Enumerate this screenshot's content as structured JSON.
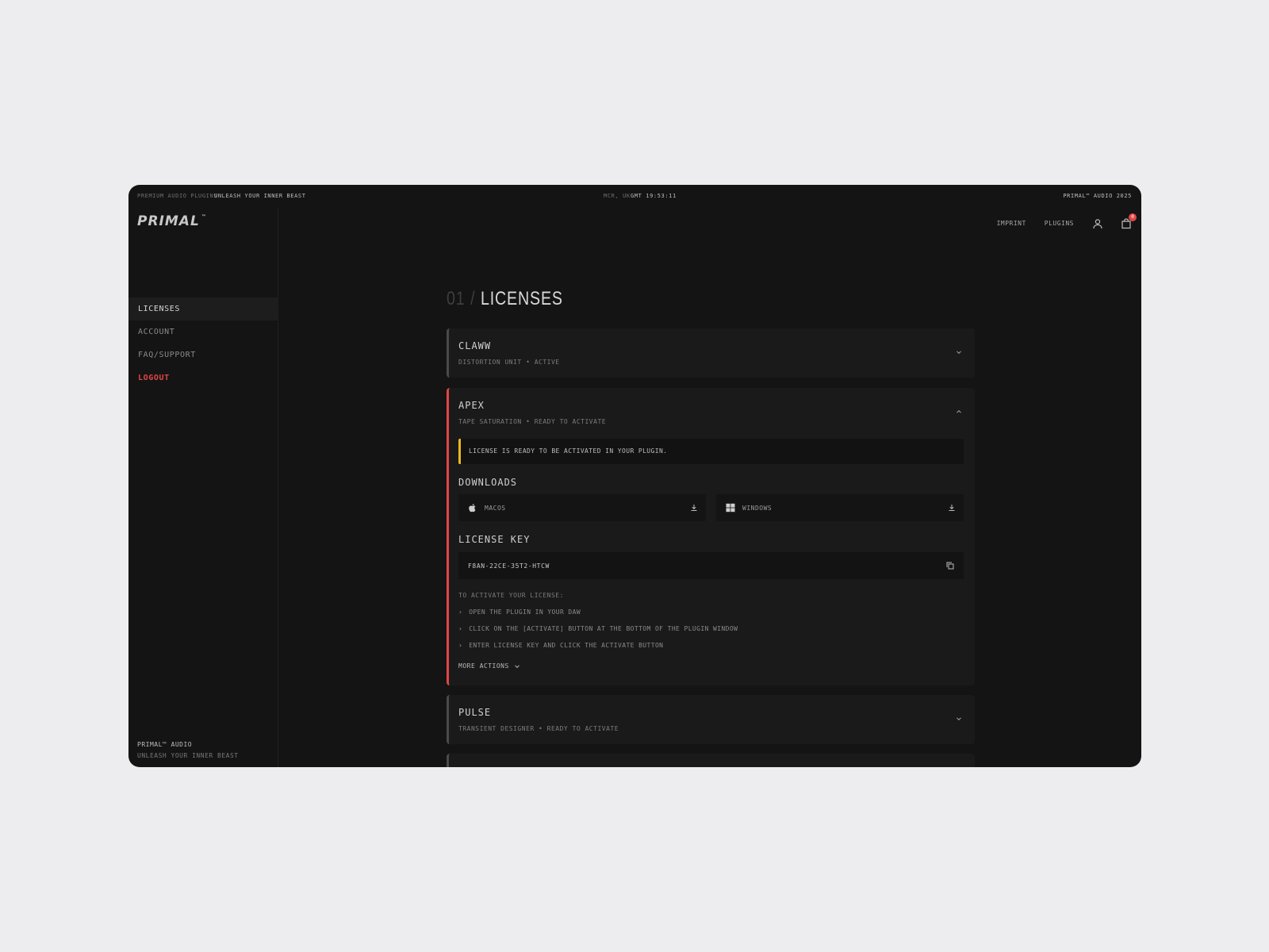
{
  "topbar": {
    "left_muted": "PREMIUM AUDIO PLUGINS",
    "left_bright": "UNLEASH YOUR INNER BEAST",
    "location": "MCR, UK",
    "time": "GMT 19:53:11",
    "right": "PRIMAL™ AUDIO 2025"
  },
  "brand": {
    "logo": "PRIMAL",
    "tm": "™"
  },
  "header": {
    "links": [
      "IMPRINT",
      "PLUGINS"
    ],
    "cart_count": "0"
  },
  "sidebar": {
    "items": [
      {
        "label": "LICENSES"
      },
      {
        "label": "ACCOUNT"
      },
      {
        "label": "FAQ/SUPPORT"
      },
      {
        "label": "LOGOUT"
      }
    ],
    "footer_title": "PRIMAL™ AUDIO",
    "footer_tagline": "UNLEASH YOUR INNER BEAST"
  },
  "main": {
    "title_num": "01",
    "title_slash": "/",
    "title": "LICENSES",
    "licenses": [
      {
        "name": "CLAWW",
        "sub": "DISTORTION UNIT • ACTIVE"
      },
      {
        "name": "APEX",
        "sub": "TAPE SATURATION • READY TO ACTIVATE"
      },
      {
        "name": "PULSE",
        "sub": "TRANSIENT DESIGNER • READY TO ACTIVATE"
      }
    ],
    "apex": {
      "notice": "LICENSE IS READY TO BE ACTIVATED IN YOUR PLUGIN.",
      "downloads_heading": "DOWNLOADS",
      "mac_label": "MACOS",
      "win_label": "WINDOWS",
      "key_heading": "LICENSE KEY",
      "key_value": "F8AN-22CE-35T2-HTCW",
      "steps_heading": "TO ACTIVATE YOUR LICENSE:",
      "steps": [
        "OPEN THE PLUGIN IN YOUR DAW",
        "CLICK ON THE [ACTIVATE] BUTTON AT THE BOTTOM OF THE PLUGIN WINDOW",
        "ENTER LICENSE KEY AND CLICK THE ACTIVATE BUTTON"
      ],
      "more_actions": "MORE ACTIONS"
    }
  },
  "colors": {
    "accent_red": "#e24646",
    "notice_yellow": "#e8b923",
    "panel_bg": "#141414"
  }
}
